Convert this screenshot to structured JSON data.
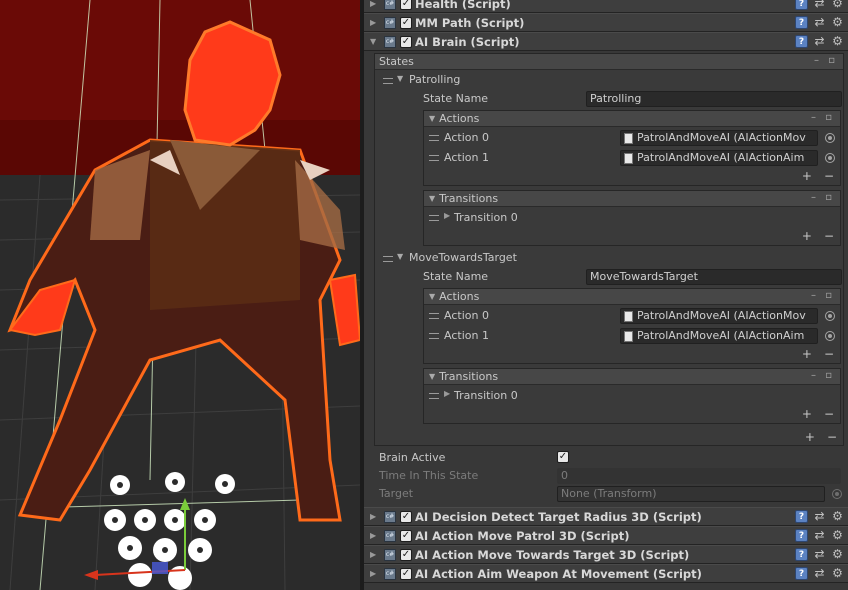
{
  "components_top": [
    {
      "title": "Health (Script)"
    },
    {
      "title": "MM Path (Script)"
    },
    {
      "title": "AI Brain (Script)"
    }
  ],
  "states_panel": {
    "label": "States"
  },
  "states": [
    {
      "name": "Patrolling",
      "state_name_label": "State Name",
      "state_name_value": "Patrolling",
      "actions_label": "Actions",
      "actions": [
        {
          "label": "Action 0",
          "value": "PatrolAndMoveAI (AIActionMov"
        },
        {
          "label": "Action 1",
          "value": "PatrolAndMoveAI (AIActionAim"
        }
      ],
      "transitions_label": "Transitions",
      "transitions": [
        {
          "label": "Transition 0"
        }
      ]
    },
    {
      "name": "MoveTowardsTarget",
      "state_name_label": "State Name",
      "state_name_value": "MoveTowardsTarget",
      "actions_label": "Actions",
      "actions": [
        {
          "label": "Action 0",
          "value": "PatrolAndMoveAI (AIActionMov"
        },
        {
          "label": "Action 1",
          "value": "PatrolAndMoveAI (AIActionAim"
        }
      ],
      "transitions_label": "Transitions",
      "transitions": [
        {
          "label": "Transition 0"
        }
      ]
    }
  ],
  "brain_fields": {
    "brain_active_label": "Brain Active",
    "time_in_state_label": "Time In This State",
    "time_in_state_value": "0",
    "target_label": "Target",
    "target_value": "None (Transform)"
  },
  "components_bottom": [
    {
      "title": "AI Decision Detect Target Radius 3D (Script)"
    },
    {
      "title": "AI Action Move Patrol 3D (Script)"
    },
    {
      "title": "AI Action Move Towards Target 3D (Script)"
    },
    {
      "title": "AI Action Aim Weapon At Movement (Script)"
    }
  ],
  "glyphs": {
    "plus": "+",
    "minus": "−",
    "check": "✓",
    "fold_open": "▼",
    "fold_closed": "▶",
    "help": "?",
    "gear": "⚙",
    "preset": "⇄",
    "minus_small": "–",
    "box": "▫",
    "script_icon_text": "c#"
  },
  "colors": {
    "selection_outline": "#ff6a1a",
    "character_head": "#ff3a1a",
    "wall": "#6a0a06",
    "help_icon": "#5b82c2"
  },
  "icons": {
    "help": "help-icon",
    "preset": "preset-icon",
    "gear": "gear-icon",
    "script": "script-icon",
    "object": "object-icon",
    "picker": "object-picker-icon"
  }
}
